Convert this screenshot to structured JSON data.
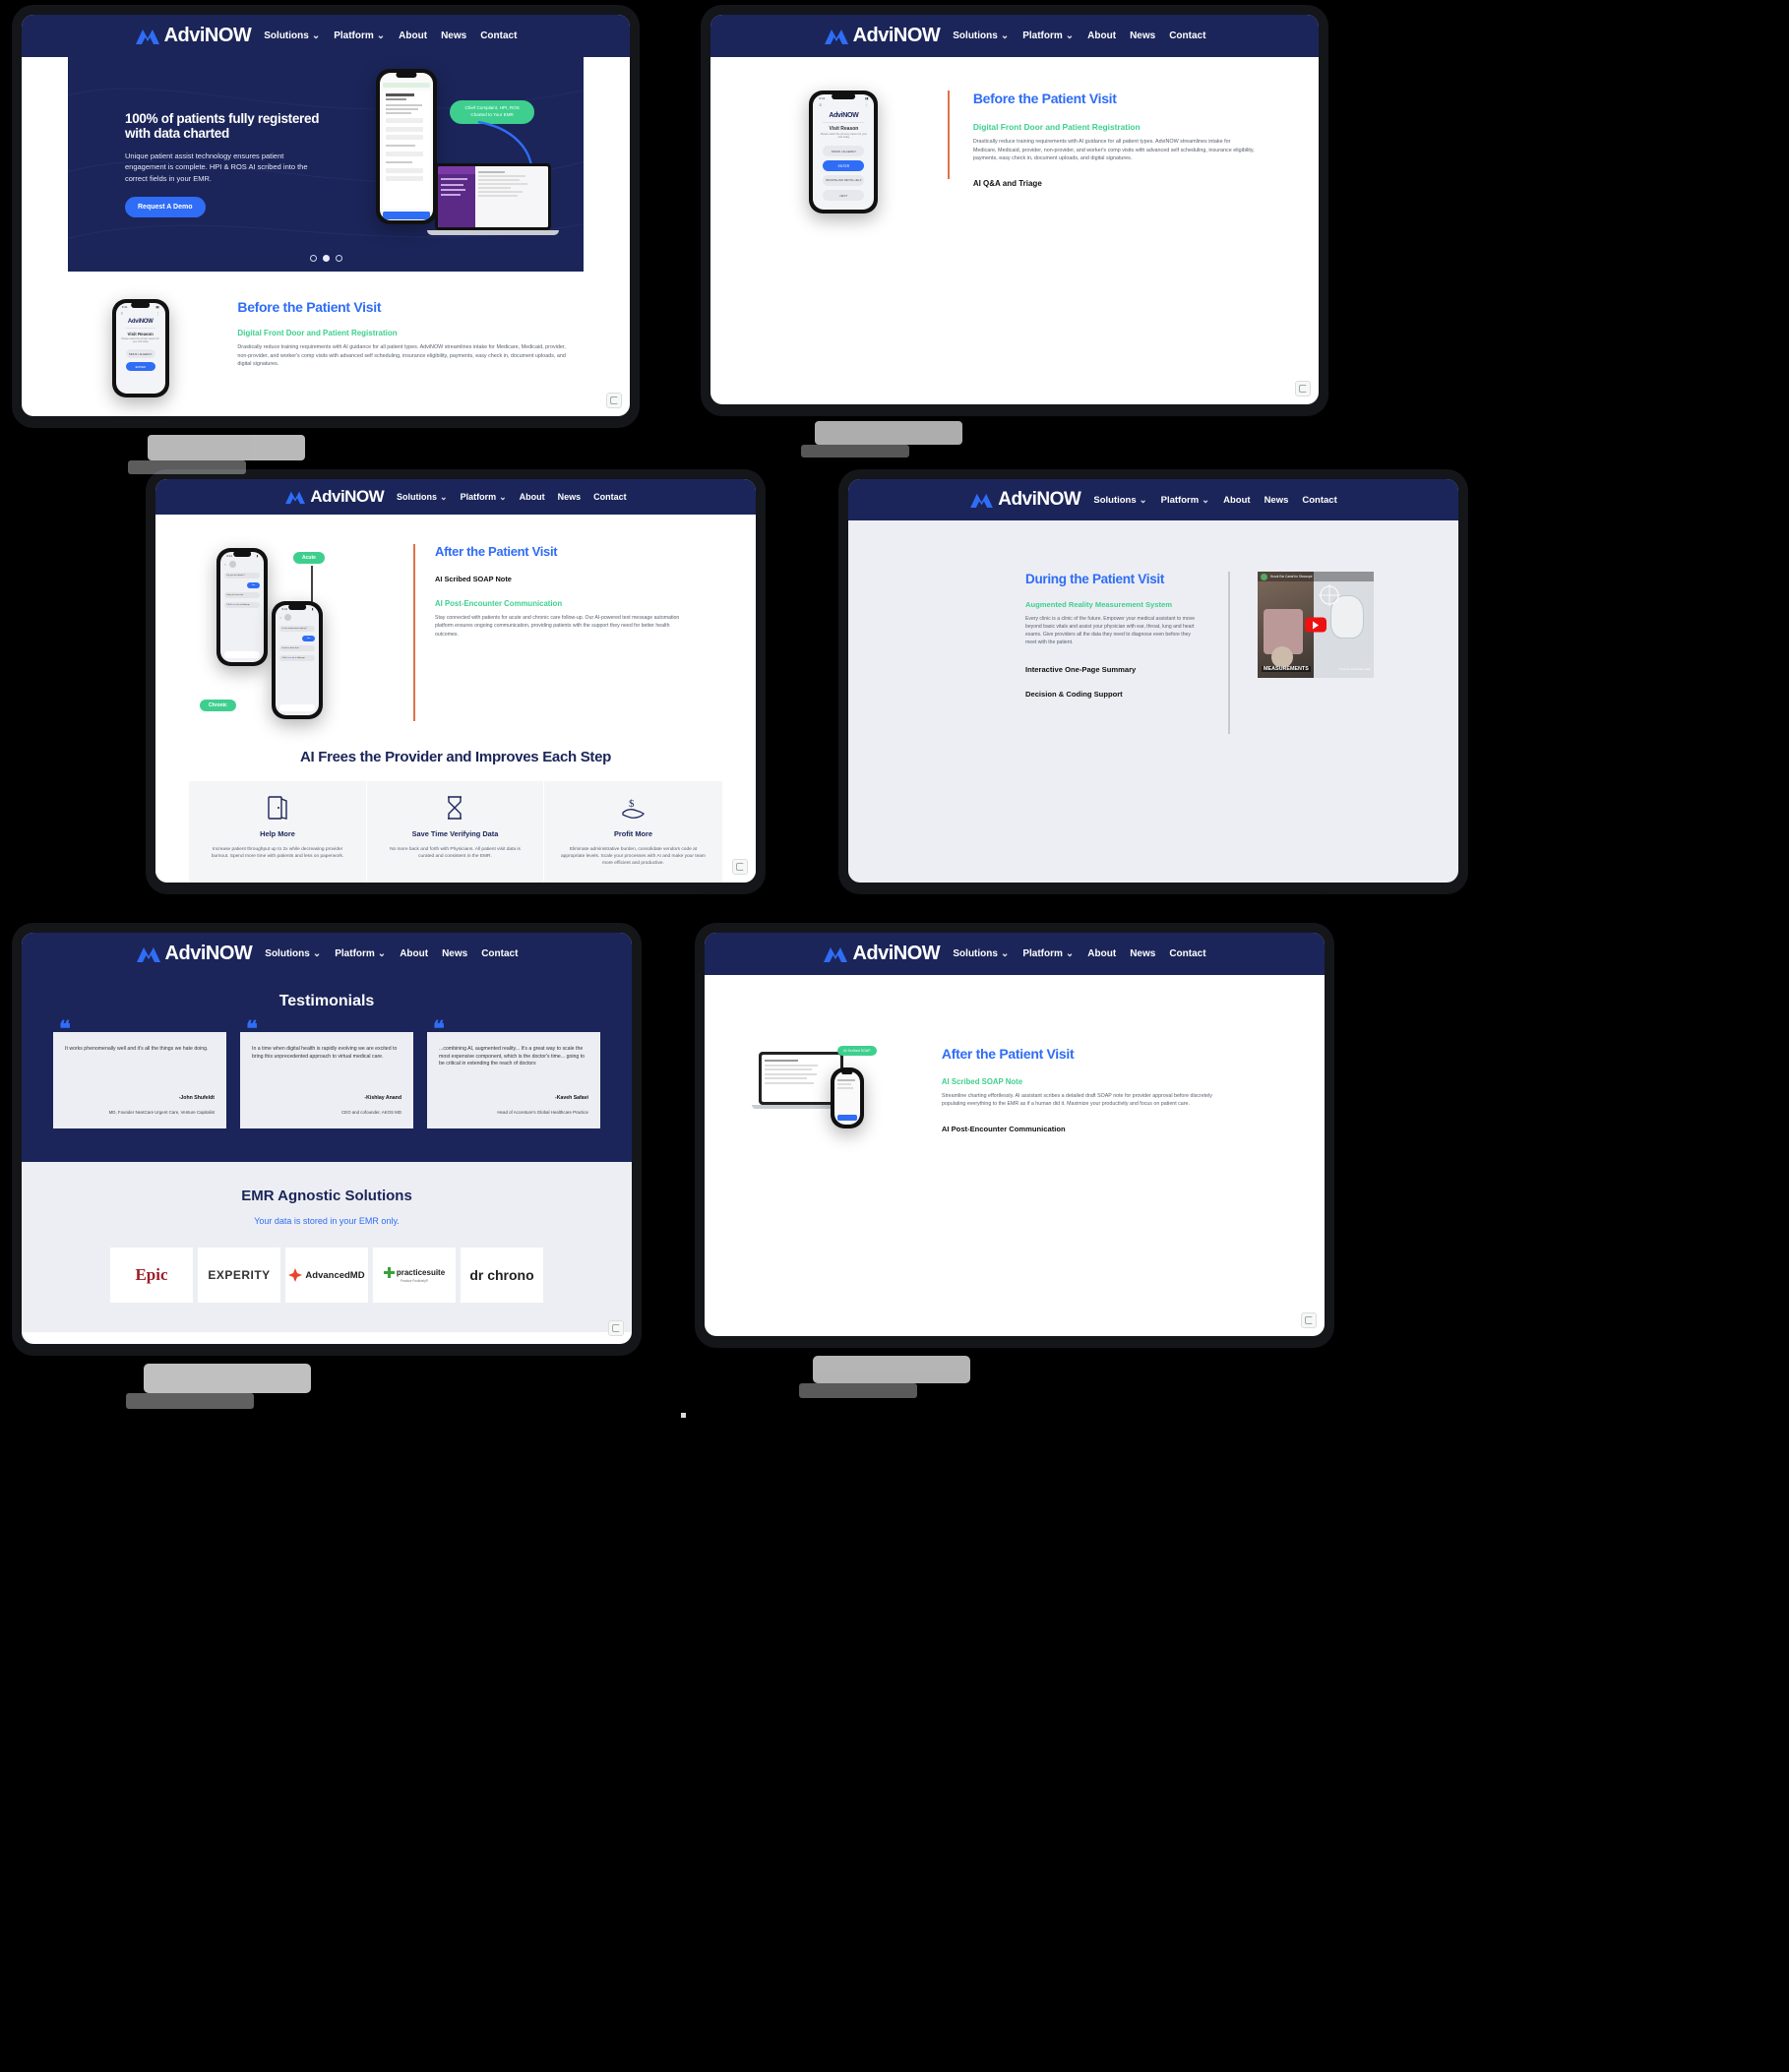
{
  "brand": {
    "name": "AdviNOW",
    "logo_icon": "advinow-mountain-logo-icon"
  },
  "nav": {
    "items": [
      {
        "label": "Solutions",
        "has_caret": true
      },
      {
        "label": "Platform",
        "has_caret": true
      },
      {
        "label": "About",
        "has_caret": false
      },
      {
        "label": "News",
        "has_caret": false
      },
      {
        "label": "Contact",
        "has_caret": false
      }
    ]
  },
  "colors": {
    "navy": "#1b2559",
    "blue": "#2f6df6",
    "green": "#3ecf8e",
    "orange_rule": "#e0714b",
    "light_grey": "#eceef3"
  },
  "hero": {
    "title": "100% of patients fully registered with data charted",
    "body": "Unique patient assist technology ensures patient engagement is complete. HPI & ROS AI scribed into the correct fields in your EMR.",
    "cta": "Request A Demo",
    "carousel": {
      "slides": 3,
      "active_index": 1
    },
    "badge": "Chief Complaint, HPI, ROS Charted to Your EMR"
  },
  "phone_ui": {
    "brand": "AdviNOW",
    "visit_reason": "Visit Reason",
    "visit_hint": "Please select the primary reason for your visit today",
    "dropdown": "SINUS / ALLERGY",
    "primary_btn": "ENTER",
    "secondary_btn": "BROWSE AND MENTAL HELP",
    "tertiary_btn": "NEXT"
  },
  "before_visit": {
    "heading": "Before the Patient Visit",
    "sub_green": "Digital Front Door and Patient Registration",
    "body": "Drastically reduce training requirements with AI guidance for all patient types. AdviNOW streamlines intake for Medicare, Medicaid, provider, non-provider, and worker's comp visits with advanced self scheduling, insurance eligibility, payments, easy check in, document uploads, and digital signatures.",
    "sub_dark": "AI Q&A and Triage"
  },
  "after_visit": {
    "heading": "After the Patient Visit",
    "sub_dark": "AI Scribed SOAP Note",
    "sub_green": "AI Post-Encounter Communication",
    "body": "Stay connected with patients for acute and chronic care follow-up. Our AI-powered text message automation platform ensures ongoing communication, providing patients with the support they need for better health outcomes.",
    "tags": {
      "acute": "Acute",
      "chronic": "Chronic"
    }
  },
  "after_visit_alt": {
    "heading": "After the Patient Visit",
    "sub_green": "AI Scribed SOAP Note",
    "body": "Streamline charting effortlessly. AI assistant scribes a detailed draft SOAP note for provider approval before discretely populating everything to the EMR as if a human did it. Maximize your productivity and focus on patient care.",
    "sub_dark": "AI Post-Encounter Communication"
  },
  "during_visit": {
    "heading": "During the Patient Visit",
    "sub_green": "Augmented Reality Measurement System",
    "body": "Every clinic is a clinic of the future. Empower your medical assistant to move beyond basic vitals and assist your physician with ear, throat, lung and heart exams. Give providers all the data they need to diagnose even before they meet with the patient.",
    "sub_dark_1": "Interactive One-Page Summary",
    "sub_dark_2": "Decision & Coding Support",
    "video": {
      "title": "Krook Ear Canal for Otoscope",
      "caption": "MEASUREMENTS",
      "hint": "Track the Otoscope in Ear",
      "play_icon": "youtube-play-icon"
    }
  },
  "provider_section": {
    "title": "AI Frees the Provider and Improves Each Step",
    "cards": [
      {
        "icon": "open-door-icon",
        "title": "Help More",
        "body": "Increase patient throughput up to 2x while decreasing provider burnout. Spend more time with patients and less on paperwork.",
        "highlight": "2x"
      },
      {
        "icon": "hourglass-icon",
        "title": "Save Time Verifying Data",
        "body": "No more back and forth with Physicians. All patient visit data is curated and consistent in the EMR.",
        "highlight": ""
      },
      {
        "icon": "money-hand-icon",
        "title": "Profit More",
        "body": "Eliminate administrative burden, consolidate vendors code at appropriate levels. Scale your processes with AI and make your team more efficient and productive.",
        "highlight": ""
      }
    ]
  },
  "testimonials": {
    "title": "Testimonials",
    "items": [
      {
        "quote": "It works phenomenally well and it's all the things we hate doing.",
        "author": "-John Shufeldt",
        "role": "MD, Founder NextCare Urgent Care, Venture Capitalist"
      },
      {
        "quote": "In a time when digital health is rapidly evolving we are excited to bring this unprecedented approach to virtual medical care.",
        "author": "-Kishlay Anand",
        "role": "CEO and cofounder, AKOS MD"
      },
      {
        "quote": "...combining AI, augmented reality... It's a great way to scale the most expensive component, which is the doctor's time... going to be critical in extending the reach of doctors",
        "author": "-Kaveh Safavi",
        "role": "Head of Accenture's Global Healthcare Practice"
      }
    ]
  },
  "emr": {
    "title": "EMR Agnostic Solutions",
    "subtitle": "Your data is stored in your EMR only.",
    "logos": [
      {
        "name": "Epic",
        "text": "Epic"
      },
      {
        "name": "Experity",
        "text": "EXPERITY"
      },
      {
        "name": "AdvancedMD",
        "text": "AdvancedMD"
      },
      {
        "name": "Practicesuite",
        "text": "practicesuite"
      },
      {
        "name": "DrChrono",
        "text": "dr chrono"
      }
    ]
  },
  "recaptcha": {
    "icon": "recaptcha-badge-icon"
  }
}
